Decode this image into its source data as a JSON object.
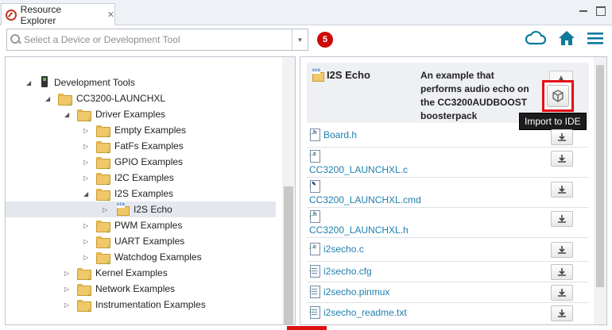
{
  "window": {
    "tab_title": "Resource Explorer",
    "tab_close": "✕",
    "tab_icon": "compass-icon",
    "buttons": [
      "minimize-icon",
      "maximize-icon"
    ]
  },
  "toolbar": {
    "search_placeholder": "Select a Device or Development Tool",
    "badge_count": "5",
    "icons": [
      "cloud-icon",
      "home-icon",
      "menu-icon"
    ],
    "accent_color": "#0d7a9c",
    "badge_color": "#cc0a0a"
  },
  "tree": {
    "collapse_label": "«",
    "items": [
      {
        "label": "Development Tools",
        "level": 0,
        "expanded": true
      },
      {
        "label": "CC3200-LAUNCHXL",
        "level": 1,
        "expanded": true
      },
      {
        "label": "Driver Examples",
        "level": 2,
        "expanded": true
      },
      {
        "label": "Empty Examples",
        "level": 3,
        "expanded": false
      },
      {
        "label": "FatFs Examples",
        "level": 3,
        "expanded": false
      },
      {
        "label": "GPIO Examples",
        "level": 3,
        "expanded": false
      },
      {
        "label": "I2C Examples",
        "level": 3,
        "expanded": false
      },
      {
        "label": "I2S Examples",
        "level": 3,
        "expanded": true
      },
      {
        "label": "I2S Echo",
        "level": 4,
        "expanded": false,
        "selected": true
      },
      {
        "label": "PWM Examples",
        "level": 3,
        "expanded": false
      },
      {
        "label": "UART Examples",
        "level": 3,
        "expanded": false
      },
      {
        "label": "Watchdog Examples",
        "level": 3,
        "expanded": false
      },
      {
        "label": "Kernel Examples",
        "level": 2,
        "expanded": false
      },
      {
        "label": "Network Examples",
        "level": 2,
        "expanded": false
      },
      {
        "label": "Instrumentation Examples",
        "level": 2,
        "expanded": false
      }
    ]
  },
  "detail": {
    "title": "I2S Echo",
    "description": "An example that performs audio echo on the CC3200AUDBOOST boosterpack",
    "import_tooltip": "Import to IDE",
    "files": [
      {
        "name": "Board.h",
        "type": "h"
      },
      {
        "name": "CC3200_LAUNCHXL.c",
        "type": "c"
      },
      {
        "name": "CC3200_LAUNCHXL.cmd",
        "type": "cmd"
      },
      {
        "name": "CC3200_LAUNCHXL.h",
        "type": "h"
      },
      {
        "name": "i2secho.c",
        "type": "c"
      },
      {
        "name": "i2secho.cfg",
        "type": "doc"
      },
      {
        "name": "i2secho.pinmux",
        "type": "doc"
      },
      {
        "name": "i2secho_readme.txt",
        "type": "doc"
      }
    ]
  }
}
